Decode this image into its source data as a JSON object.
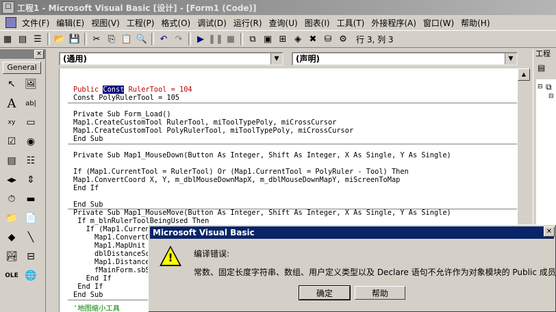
{
  "window": {
    "title": "工程1 - Microsoft Visual Basic [设计] - [Form1 (Code)]"
  },
  "menu": [
    "文件(F)",
    "编辑(E)",
    "视图(V)",
    "工程(P)",
    "格式(O)",
    "调试(D)",
    "运行(R)",
    "查询(U)",
    "图表(I)",
    "工具(T)",
    "外接程序(A)",
    "窗口(W)",
    "帮助(H)"
  ],
  "toolbar": {
    "position": "行 3, 列 3"
  },
  "toolbox": {
    "tab": "General",
    "tool_labels": [
      "A",
      "ab|",
      "xy"
    ]
  },
  "code": {
    "object_combo": "(通用)",
    "proc_combo": "(声明)",
    "lines": [
      {
        "text": "Public ",
        "rest": " RulerTool = 104",
        "sel": "Const"
      },
      {
        "text": "Const PolyRulerTool = 105"
      },
      {
        "text": "Private Sub Form_Load()"
      },
      {
        "text": "Map1.CreateCustomTool RulerTool, miToolTypePoly, miCrossCursor"
      },
      {
        "text": "Map1.CreateCustomTool PolyRulerTool, miToolTypePoly, miCrossCursor"
      },
      {
        "text": "End Sub"
      },
      {
        "text": "Private Sub Map1_MouseDown(Button As Integer, Shift As Integer, X As Single, Y As Single)"
      },
      {
        "text": "If (Map1.CurrentTool = RulerTool) Or (Map1.CurrentTool = PolyRuler - Tool) Then"
      },
      {
        "text": "Map1.ConvertCoord X, Y, m_dblMouseDownMapX, m_dblMouseDownMapY, miScreenToMap"
      },
      {
        "text": "End If"
      },
      {
        "text": "End Sub"
      },
      {
        "text": "Private Sub Map1_MouseMove(Button As Integer, Shift As Integer, X As Single, Y As Single)"
      },
      {
        "text": " If m_blnRulerToolBeingUsed Then"
      },
      {
        "text": "   If (Map1.CurrentT"
      },
      {
        "text": "     Map1.ConvertC"
      },
      {
        "text": "     Map1.MapUnit"
      },
      {
        "text": "     dblDistanceSc"
      },
      {
        "text": "     Map1.Distance"
      },
      {
        "text": "     fMainForm.sbS"
      },
      {
        "text": "   End If"
      },
      {
        "text": " End If"
      },
      {
        "text": "End Sub"
      },
      {
        "text": "'地图缩小工具"
      }
    ]
  },
  "project": {
    "title": "工程"
  },
  "dialog": {
    "title": "Microsoft Visual Basic",
    "heading": "编译错误:",
    "message": "常数、固定长度字符串、数组、用户定义类型以及 Declare 语句不允许作为对象模块的 Public 成员。",
    "ok": "确定",
    "help": "帮助"
  }
}
